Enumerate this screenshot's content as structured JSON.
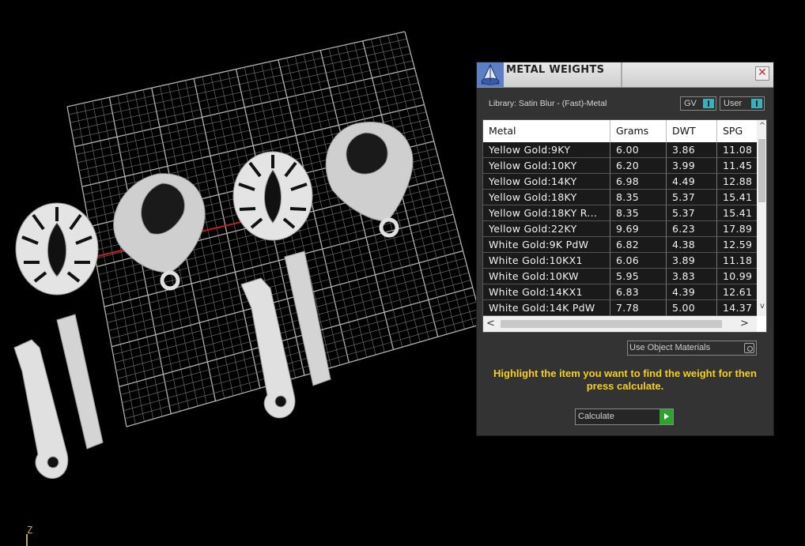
{
  "viewport": {
    "axis_label": "Z"
  },
  "panel": {
    "title": "METAL WEIGHTS",
    "close_icon": "close-icon",
    "library_label": "Library: Satin Blur - (Fast)-Metal",
    "toggle_gv": "GV",
    "toggle_user": "User",
    "columns": [
      "Metal",
      "Grams",
      "DWT",
      "SPG"
    ],
    "rows": [
      [
        "Yellow Gold:9KY",
        "6.00",
        "3.86",
        "11.08"
      ],
      [
        "Yellow Gold:10KY",
        "6.20",
        "3.99",
        "11.45"
      ],
      [
        "Yellow Gold:14KY",
        "6.98",
        "4.49",
        "12.88"
      ],
      [
        "Yellow Gold:18KY",
        "8.35",
        "5.37",
        "15.41"
      ],
      [
        "Yellow Gold:18KY R...",
        "8.35",
        "5.37",
        "15.41"
      ],
      [
        "Yellow Gold:22KY",
        "9.69",
        "6.23",
        "17.89"
      ],
      [
        "White Gold:9K PdW",
        "6.82",
        "4.38",
        "12.59"
      ],
      [
        "White Gold:10KX1",
        "6.06",
        "3.89",
        "11.18"
      ],
      [
        "White Gold:10KW",
        "5.95",
        "3.83",
        "10.99"
      ],
      [
        "White Gold:14KX1",
        "6.83",
        "4.39",
        "12.61"
      ],
      [
        "White Gold:14K PdW",
        "7.78",
        "5.00",
        "14.37"
      ]
    ],
    "use_object_materials": "Use Object Materials",
    "hint": "Highlight the item you want to find the weight for then press calculate.",
    "calculate_label": "Calculate",
    "colors": {
      "hint": "#f5d020",
      "panel_bg": "#333333",
      "calc_go": "#2ea22e"
    }
  }
}
